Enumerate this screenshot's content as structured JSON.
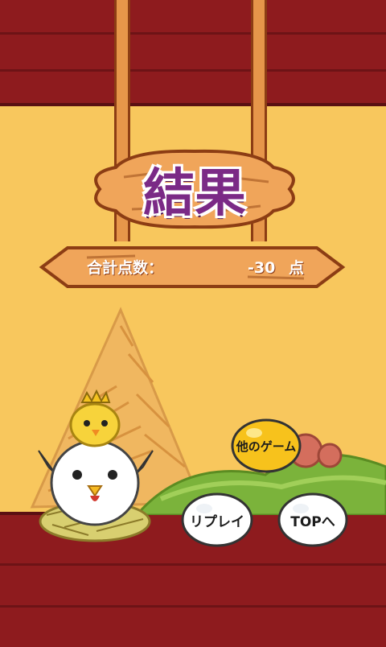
{
  "title": "結果",
  "score": {
    "label": "合計点数：",
    "value": "-30",
    "unit": "点"
  },
  "buttons": {
    "other_games": "他のゲーム",
    "replay": "リプレイ",
    "top": "TOPへ"
  },
  "colors": {
    "wood_red": "#8e1b1e",
    "sky_yellow": "#f8c75d",
    "sign_orange": "#f0a55a",
    "title_purple": "#7b2a86",
    "golden_egg": "#f7c21c"
  },
  "icons": [
    "chick-with-crown-icon",
    "hen-icon",
    "nest-icon",
    "golden-egg-icon",
    "white-egg-icon"
  ]
}
